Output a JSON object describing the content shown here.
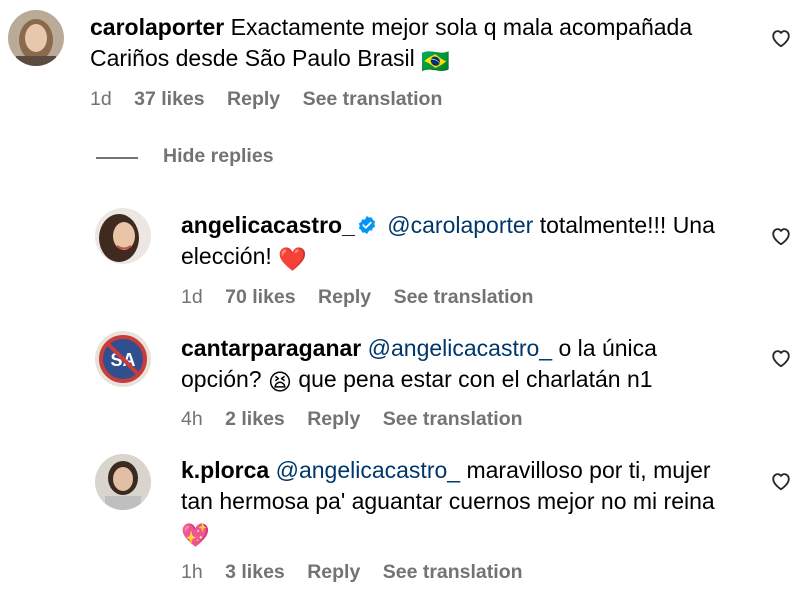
{
  "comments": [
    {
      "username": "carolaporter",
      "text_line1": "Exactamente mejor sola q mala acompañada",
      "text_line2": "Cariños desde São Paulo Brasil",
      "flag_emoji": "🇧🇷",
      "time": "1d",
      "likes": "37 likes",
      "reply": "Reply",
      "translate": "See translation"
    }
  ],
  "hide_replies": "Hide replies",
  "replies": [
    {
      "username": "angelicacastro_",
      "verified": true,
      "mention": "@carolaporter",
      "text_line1": " totalmente!!! Una",
      "text_line2": "elección! ",
      "emoji": "❤️",
      "time": "1d",
      "likes": "70 likes",
      "reply": "Reply",
      "translate": "See translation"
    },
    {
      "username": "cantarparaganar",
      "mention": "@angelicacastro_",
      "text_line1": " o la única",
      "text_line2_pre": "opción? ",
      "emoji": "😫",
      "text_line2_post": " que pena estar con el charlatán n1",
      "time": "4h",
      "likes": "2 likes",
      "reply": "Reply",
      "translate": "See translation"
    },
    {
      "username": "k.plorca",
      "mention": "@angelicacastro_",
      "text_line1": " maravilloso por ti, mujer",
      "text_line2": "tan hermosa pa' aguantar cuernos mejor no mi reina",
      "emoji": "💖",
      "time": "1h",
      "likes": "3 likes",
      "reply": "Reply",
      "translate": "See translation"
    }
  ],
  "icons": {
    "like": "heart-outline-icon",
    "verified": "verified-badge-icon"
  },
  "colors": {
    "text": "#000000",
    "muted": "#737373",
    "mention": "#00376b",
    "verified": "#0095f6"
  }
}
